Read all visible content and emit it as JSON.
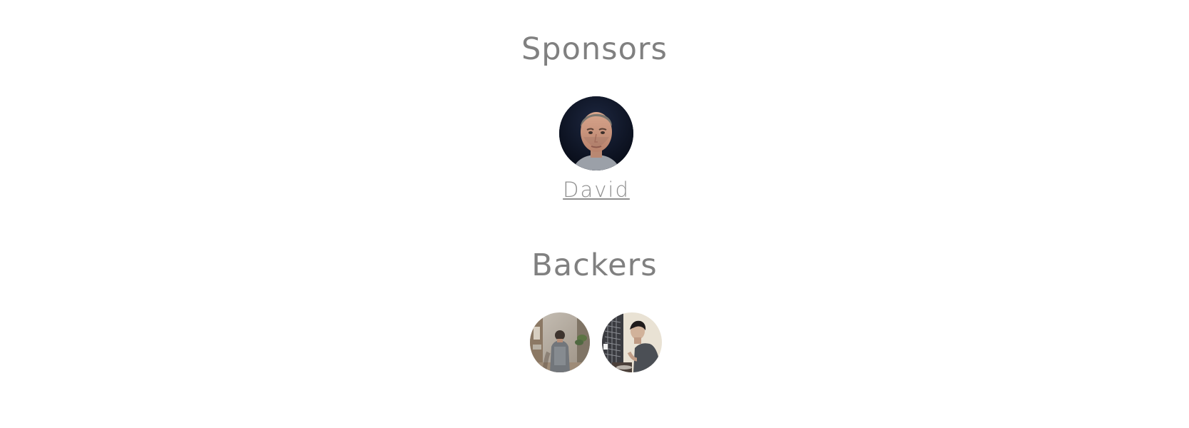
{
  "sponsors": {
    "title": "Sponsors",
    "items": [
      {
        "name": "David",
        "avatar_icon": "sponsor-avatar-photo"
      }
    ]
  },
  "backers": {
    "title": "Backers",
    "items": [
      {
        "avatar_icon": "backer-avatar-photo-1"
      },
      {
        "avatar_icon": "backer-avatar-photo-2"
      }
    ]
  },
  "colors": {
    "heading": "#808080",
    "name": "#8f8f8f",
    "background": "#ffffff"
  }
}
